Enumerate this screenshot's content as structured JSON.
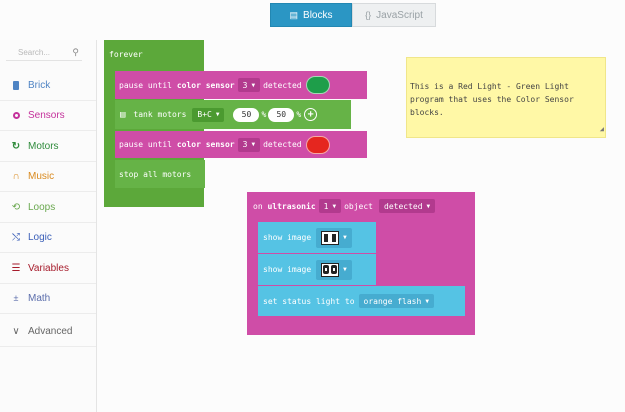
{
  "tabs": [
    {
      "label": "Blocks",
      "icon": "blocks-icon",
      "active": true
    },
    {
      "label": "JavaScript",
      "icon": "code-braces-icon",
      "active": false
    }
  ],
  "sidebar": {
    "search_placeholder": "Search...",
    "categories": [
      {
        "label": "Brick",
        "color": "#4f84c4",
        "icon": "brick-icon"
      },
      {
        "label": "Sensors",
        "color": "#c4319b",
        "icon": "sensor-icon"
      },
      {
        "label": "Motors",
        "color": "#2e8b3b",
        "icon": "motor-icon"
      },
      {
        "label": "Music",
        "color": "#d98a1f",
        "icon": "headphones-icon"
      },
      {
        "label": "Loops",
        "color": "#6aa84f",
        "icon": "loop-icon"
      },
      {
        "label": "Logic",
        "color": "#3b5fb8",
        "icon": "shuffle-icon"
      },
      {
        "label": "Variables",
        "color": "#a61b2b",
        "icon": "list-icon"
      },
      {
        "label": "Math",
        "color": "#5b6dab",
        "icon": "math-icon"
      },
      {
        "label": "Advanced",
        "color": "#666666",
        "icon": "chevron-down-icon"
      }
    ]
  },
  "forever_block": {
    "label": "forever",
    "pause1": {
      "prefix": "pause until",
      "sensor": "color sensor",
      "port": "3",
      "suffix": "detected",
      "swatch": "#1e9e4a"
    },
    "tank": {
      "label": "tank motors",
      "ports": "B+C",
      "speed1": "50",
      "pct1": "%",
      "speed2": "50",
      "pct2": "%"
    },
    "pause2": {
      "prefix": "pause until",
      "sensor": "color sensor",
      "port": "3",
      "suffix": "detected",
      "swatch": "#e5261f"
    },
    "stop": "stop all motors"
  },
  "ultrasonic_block": {
    "prefix": "on",
    "sensor": "ultrasonic",
    "port": "1",
    "object": "object",
    "event": "detected",
    "show1": "show image",
    "show2": "show image",
    "status_prefix": "set status light to",
    "status_value": "orange flash"
  },
  "note": {
    "text": "This is a Red Light - Green Light program that uses the Color Sensor blocks."
  }
}
